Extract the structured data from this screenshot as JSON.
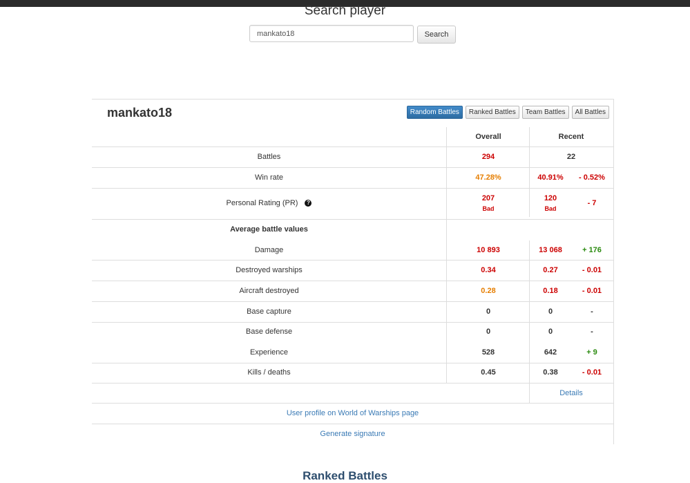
{
  "search": {
    "title": "Search player",
    "input_value": "mankato18",
    "button_label": "Search"
  },
  "player": {
    "name": "mankato18"
  },
  "battle_types": [
    "Random Battles",
    "Ranked Battles",
    "Team Battles",
    "All Battles"
  ],
  "active_battle_type": "Random Battles",
  "table": {
    "headers": {
      "overall": "Overall",
      "recent": "Recent"
    },
    "battles": {
      "label": "Battles",
      "overall": "294",
      "recent": "22"
    },
    "win_rate": {
      "label": "Win rate",
      "overall": "47.28%",
      "recent": "40.91%",
      "diff": "- 0.52%"
    },
    "pr": {
      "label": "Personal Rating (PR)",
      "help_icon": "question-circle-icon",
      "overall": "207",
      "overall_rating": "Bad",
      "recent": "120",
      "recent_rating": "Bad",
      "diff": "- 7"
    },
    "avg_heading": "Average battle values",
    "damage": {
      "label": "Damage",
      "overall": "10 893",
      "recent": "13 068",
      "diff": "+ 176"
    },
    "destroyed_warships": {
      "label": "Destroyed warships",
      "overall": "0.34",
      "recent": "0.27",
      "diff": "- 0.01"
    },
    "aircraft_destroyed": {
      "label": "Aircraft destroyed",
      "overall": "0.28",
      "recent": "0.18",
      "diff": "- 0.01"
    },
    "base_capture": {
      "label": "Base capture",
      "overall": "0",
      "recent": "0",
      "diff": "-"
    },
    "base_defense": {
      "label": "Base defense",
      "overall": "0",
      "recent": "0",
      "diff": "-"
    },
    "experience": {
      "label": "Experience",
      "overall": "528",
      "recent": "642",
      "diff": "+ 9"
    },
    "kills_deaths": {
      "label": "Kills / deaths",
      "overall": "0.45",
      "recent": "0.38",
      "diff": "- 0.01"
    }
  },
  "links": {
    "details": "Details",
    "profile": "User profile on World of Warships page",
    "signature": "Generate signature"
  },
  "ranked_heading": "Ranked Battles",
  "colors": {
    "bad": "#cc0000",
    "below_average": "#e67e00",
    "positive": "#2a8a0e",
    "link": "#3a7ab5",
    "active_button": "#428bca"
  }
}
